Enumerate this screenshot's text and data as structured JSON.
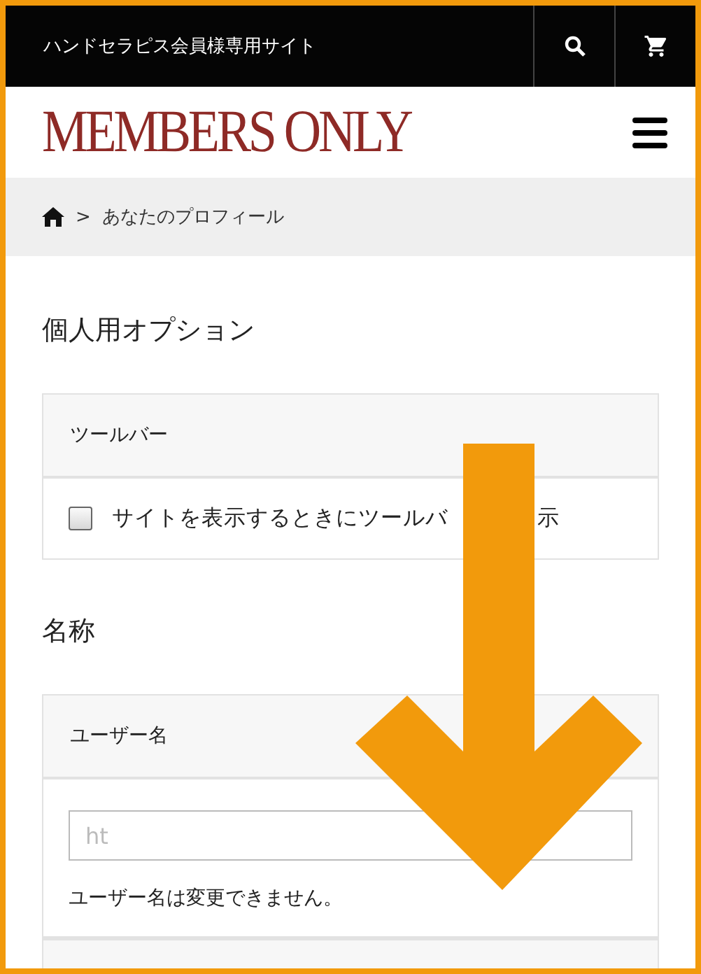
{
  "topbar": {
    "title": "ハンドセラピス会員様専用サイト"
  },
  "header": {
    "logo": "MEMBERS ONLY"
  },
  "breadcrumb": {
    "separator": ">",
    "current": "あなたのプロフィール"
  },
  "sections": [
    {
      "heading": "個人用オプション",
      "cards": [
        {
          "kind": "checkbox",
          "title": "ツールバー",
          "label_start": "サイトを表示するときにツールバ",
          "label_end": "示",
          "checked": false
        }
      ]
    },
    {
      "heading": "名称",
      "cards": [
        {
          "kind": "field",
          "title": "ユーザー名",
          "value": "ht",
          "disabled": true,
          "note": "ユーザー名は変更できません。"
        },
        {
          "kind": "stub"
        }
      ]
    }
  ]
}
